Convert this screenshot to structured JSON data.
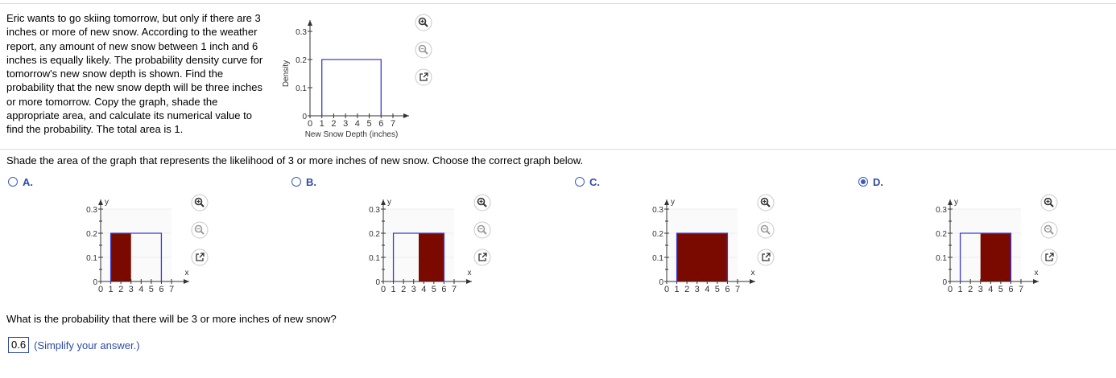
{
  "problem": {
    "text": "Eric wants to go skiing tomorrow, but only if there are 3\ninches or more of new snow. According to the weather\nreport, any amount of new snow between 1 inch and 6\ninches is equally likely. The probability density curve for\ntomorrow's new snow depth is shown. Find the\nprobability that the new snow depth will be three inches\nor more tomorrow. Copy the graph, shade the\nappropriate area, and calculate its numerical value to\nfind the probability. The total area is 1."
  },
  "main_graph": {
    "ylabel": "Density",
    "xlabel": "New Snow Depth (inches)"
  },
  "prompt": "Shade the area of the graph that represents the likelihood of 3 or more inches of new snow. Choose the correct graph below.",
  "options": [
    {
      "letter": "A.",
      "selected": false
    },
    {
      "letter": "B.",
      "selected": false
    },
    {
      "letter": "C.",
      "selected": false
    },
    {
      "letter": "D.",
      "selected": true
    }
  ],
  "option_axis": {
    "xlabel": "x",
    "ylabel": "y"
  },
  "question": "What is the probability that there will be 3 or more inches of new snow?",
  "answer": {
    "value": "0.6",
    "hint": "(Simplify your answer.)"
  },
  "colors": {
    "curve": "#3a3ad6",
    "shade": "#7a0a00",
    "accent": "#2e4aa8"
  },
  "icons": [
    "zoom-in-icon",
    "zoom-out-icon",
    "external-link-icon"
  ],
  "chart_data": [
    {
      "type": "area",
      "role": "main",
      "x": [
        1,
        6
      ],
      "y": [
        0.2,
        0.2
      ],
      "xlim": [
        0,
        7
      ],
      "ylim": [
        0,
        0.3
      ],
      "xticks": [
        0,
        1,
        2,
        3,
        4,
        5,
        6,
        7
      ],
      "yticks": [
        0,
        0.1,
        0.2,
        0.3
      ],
      "xlabel": "New Snow Depth (inches)",
      "ylabel": "Density",
      "shaded": null
    },
    {
      "type": "area",
      "option": "A",
      "x": [
        1,
        6
      ],
      "y": [
        0.2,
        0.2
      ],
      "xlim": [
        0,
        7
      ],
      "ylim": [
        0,
        0.3
      ],
      "xticks": [
        0,
        1,
        2,
        3,
        4,
        5,
        6,
        7
      ],
      "yticks": [
        0,
        0.1,
        0.2,
        0.3
      ],
      "xlabel": "x",
      "ylabel": "y",
      "shaded": [
        1,
        3
      ]
    },
    {
      "type": "area",
      "option": "B",
      "x": [
        1,
        6
      ],
      "y": [
        0.2,
        0.2
      ],
      "xlim": [
        0,
        7
      ],
      "ylim": [
        0,
        0.3
      ],
      "xticks": [
        0,
        1,
        2,
        3,
        4,
        5,
        6,
        7
      ],
      "yticks": [
        0,
        0.1,
        0.2,
        0.3
      ],
      "xlabel": "x",
      "ylabel": "y",
      "shaded": [
        3.5,
        6
      ]
    },
    {
      "type": "area",
      "option": "C",
      "x": [
        1,
        6
      ],
      "y": [
        0.2,
        0.2
      ],
      "xlim": [
        0,
        7
      ],
      "ylim": [
        0,
        0.3
      ],
      "xticks": [
        0,
        1,
        2,
        3,
        4,
        5,
        6,
        7
      ],
      "yticks": [
        0,
        0.1,
        0.2,
        0.3
      ],
      "xlabel": "x",
      "ylabel": "y",
      "shaded": [
        1,
        6
      ]
    },
    {
      "type": "area",
      "option": "D",
      "x": [
        1,
        6
      ],
      "y": [
        0.2,
        0.2
      ],
      "xlim": [
        0,
        7
      ],
      "ylim": [
        0,
        0.3
      ],
      "xticks": [
        0,
        1,
        2,
        3,
        4,
        5,
        6,
        7
      ],
      "yticks": [
        0,
        0.1,
        0.2,
        0.3
      ],
      "xlabel": "x",
      "ylabel": "y",
      "shaded": [
        3,
        6
      ]
    }
  ]
}
